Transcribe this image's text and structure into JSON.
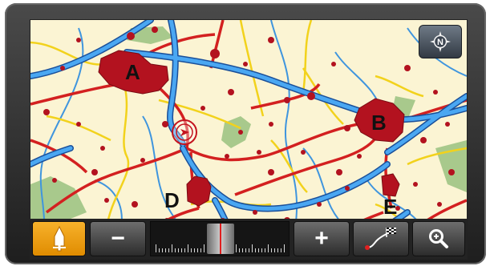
{
  "map": {
    "labels": {
      "a": "A",
      "b": "B",
      "d": "D",
      "e": "E"
    },
    "colors": {
      "background": "#fbf4d3",
      "water": "#3a8fd9",
      "road_major": "#d32020",
      "road_minor": "#f2d21c",
      "city": "#b3121f",
      "forest": "#a8c98c"
    }
  },
  "compass": {
    "icon": "compass-north-icon",
    "letter": "N"
  },
  "toolbar": {
    "recenter_icon": "vehicle-position-icon",
    "zoom_out_label": "−",
    "zoom_in_label": "+",
    "route_icon": "route-flag-icon",
    "search_icon": "zoom-search-icon",
    "zoom_level_fraction": 0.5,
    "accent": "#f5a623"
  }
}
